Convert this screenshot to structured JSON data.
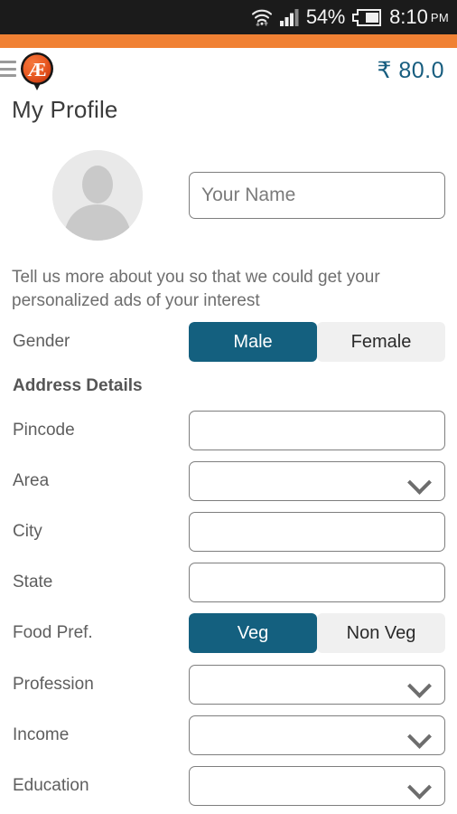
{
  "statusbar": {
    "wifi_icon": "wifi-icon",
    "data_arrows_icon": "data-transfer-icon",
    "signal_icon": "cellular-signal-icon",
    "battery_percent": "54%",
    "battery_icon": "battery-icon",
    "time": "8:10",
    "ampm": "PM"
  },
  "header": {
    "menu_icon": "hamburger-menu-icon",
    "logo_icon": "app-logo-pin-icon",
    "logo_text": "Æ",
    "balance": "₹ 80.0",
    "accent_orange": "#f08134",
    "accent_teal": "#14607f"
  },
  "page": {
    "title": "My Profile",
    "avatar_icon": "user-avatar-placeholder-icon",
    "name_placeholder": "Your Name",
    "name_value": "",
    "tagline": "Tell us more about you so that we could get your personalized ads of your interest"
  },
  "form": {
    "gender": {
      "label": "Gender",
      "options": [
        "Male",
        "Female"
      ],
      "selected": "Male"
    },
    "section_address": "Address Details",
    "pincode": {
      "label": "Pincode",
      "value": ""
    },
    "area": {
      "label": "Area",
      "value": ""
    },
    "city": {
      "label": "City",
      "value": ""
    },
    "state": {
      "label": "State",
      "value": ""
    },
    "food_pref": {
      "label": "Food Pref.",
      "options": [
        "Veg",
        "Non Veg"
      ],
      "selected": "Veg"
    },
    "profession": {
      "label": "Profession",
      "value": ""
    },
    "income": {
      "label": "Income",
      "value": ""
    },
    "education": {
      "label": "Education",
      "value": ""
    },
    "dropdown_icon": "chevron-down-icon"
  }
}
